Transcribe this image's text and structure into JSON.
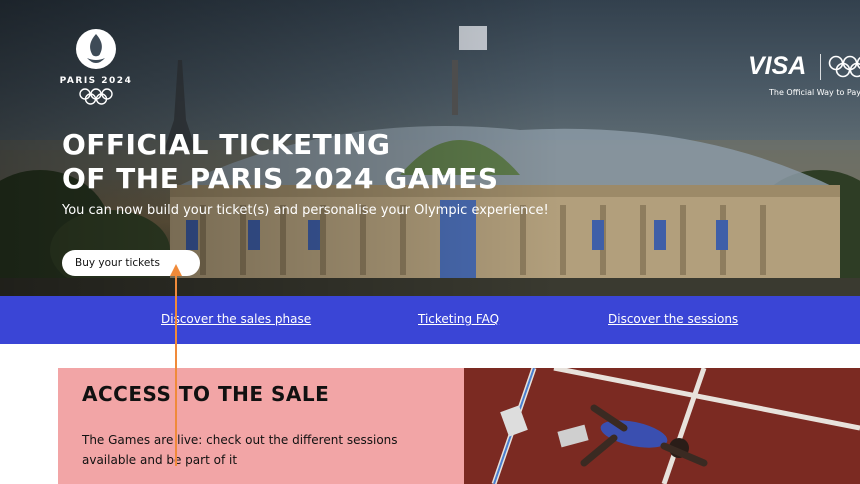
{
  "hero": {
    "logo": {
      "text": "PARIS 2024",
      "icon": "paris-2024-flame-icon"
    },
    "sponsor": {
      "brand": "VISA",
      "tagline": "The Official Way to Pay"
    },
    "headline_line1": "OFFICIAL TICKETING",
    "headline_line2": "OF THE PARIS 2024 GAMES",
    "subline": "You can now build your ticket(s) and personalise your Olympic experience!",
    "cta_label": "Buy your tickets"
  },
  "nav": {
    "links": [
      {
        "label": "Discover the sales phase"
      },
      {
        "label": "Ticketing FAQ"
      },
      {
        "label": "Discover the sessions"
      }
    ]
  },
  "access": {
    "title": "ACCESS TO THE SALE",
    "text": "The Games are live: check out the different sessions available and be part of it"
  },
  "colors": {
    "nav_bg": "#3a45d6",
    "card_bg": "#f2a5a6",
    "annotation": "#f08a3a",
    "track": "#7b2a22"
  }
}
